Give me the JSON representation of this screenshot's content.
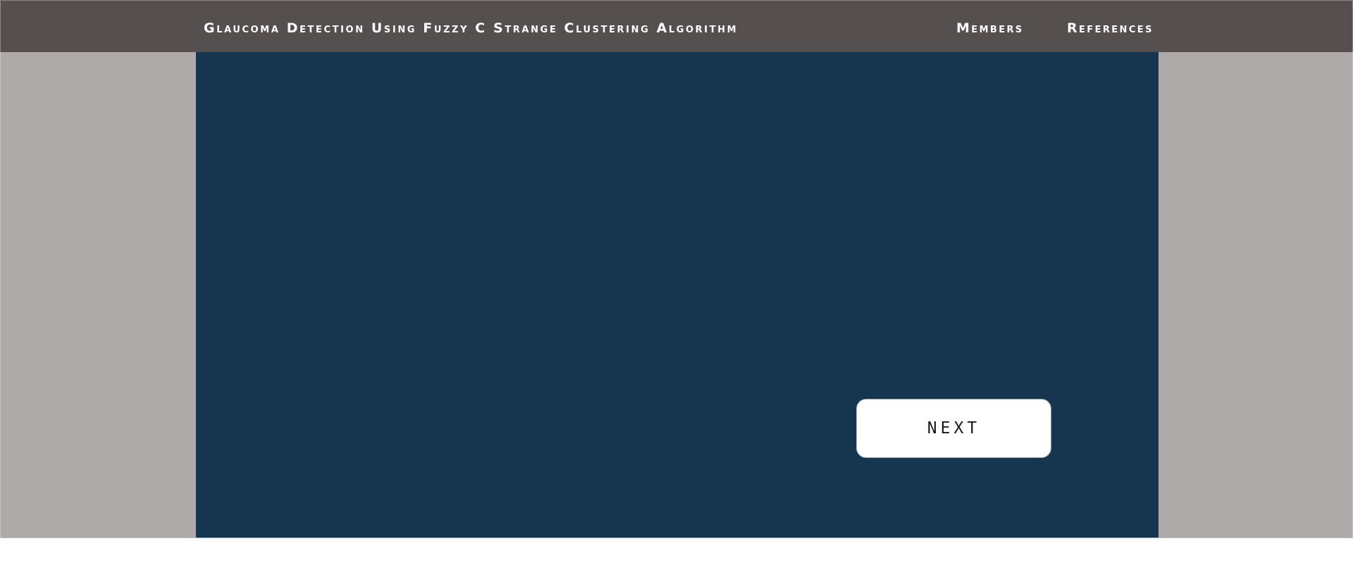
{
  "header": {
    "title": "Glaucoma Detection Using Fuzzy C Strange Clustering Algorithm",
    "nav": {
      "members": "Members",
      "references": "References"
    }
  },
  "main": {
    "next_label": "NEXT"
  },
  "colors": {
    "header_bg": "#564f4f",
    "page_bg": "#aeaaa9",
    "panel_bg": "#16354f",
    "button_bg": "#ffffff"
  }
}
